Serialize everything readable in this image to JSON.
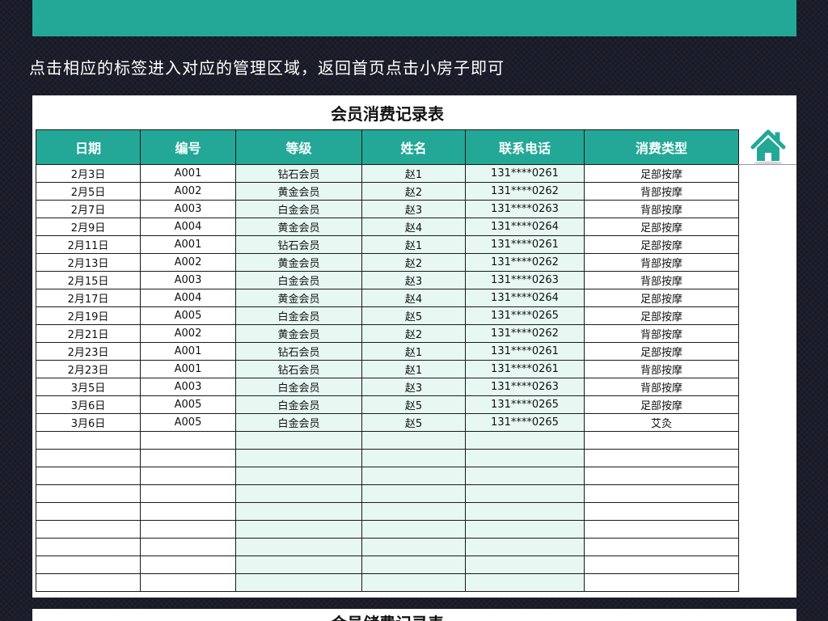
{
  "banner": {
    "instruction": "点击相应的标签进入对应的管理区域，返回首页点击小房子即可"
  },
  "sheet": {
    "title": "会员消费记录表",
    "columns": [
      "日期",
      "编号",
      "等级",
      "姓名",
      "联系电话",
      "消费类型"
    ],
    "rows": [
      [
        "2月3日",
        "A001",
        "钻石会员",
        "赵1",
        "131****0261",
        "足部按摩"
      ],
      [
        "2月5日",
        "A002",
        "黄金会员",
        "赵2",
        "131****0262",
        "背部按摩"
      ],
      [
        "2月7日",
        "A003",
        "白金会员",
        "赵3",
        "131****0263",
        "背部按摩"
      ],
      [
        "2月9日",
        "A004",
        "黄金会员",
        "赵4",
        "131****0264",
        "足部按摩"
      ],
      [
        "2月11日",
        "A001",
        "钻石会员",
        "赵1",
        "131****0261",
        "足部按摩"
      ],
      [
        "2月13日",
        "A002",
        "黄金会员",
        "赵2",
        "131****0262",
        "背部按摩"
      ],
      [
        "2月15日",
        "A003",
        "白金会员",
        "赵3",
        "131****0263",
        "背部按摩"
      ],
      [
        "2月17日",
        "A004",
        "黄金会员",
        "赵4",
        "131****0264",
        "足部按摩"
      ],
      [
        "2月19日",
        "A005",
        "白金会员",
        "赵5",
        "131****0265",
        "足部按摩"
      ],
      [
        "2月21日",
        "A002",
        "黄金会员",
        "赵2",
        "131****0262",
        "背部按摩"
      ],
      [
        "2月23日",
        "A001",
        "钻石会员",
        "赵1",
        "131****0261",
        "足部按摩"
      ],
      [
        "2月23日",
        "A001",
        "钻石会员",
        "赵1",
        "131****0261",
        "背部按摩"
      ],
      [
        "3月5日",
        "A003",
        "白金会员",
        "赵3",
        "131****0263",
        "背部按摩"
      ],
      [
        "3月6日",
        "A005",
        "白金会员",
        "赵5",
        "131****0265",
        "足部按摩"
      ],
      [
        "3月6日",
        "A005",
        "白金会员",
        "赵5",
        "131****0265",
        "艾灸"
      ],
      [
        "",
        "",
        "",
        "",
        "",
        ""
      ],
      [
        "",
        "",
        "",
        "",
        "",
        ""
      ],
      [
        "",
        "",
        "",
        "",
        "",
        ""
      ],
      [
        "",
        "",
        "",
        "",
        "",
        ""
      ],
      [
        "",
        "",
        "",
        "",
        "",
        ""
      ],
      [
        "",
        "",
        "",
        "",
        "",
        ""
      ],
      [
        "",
        "",
        "",
        "",
        "",
        ""
      ],
      [
        "",
        "",
        "",
        "",
        "",
        ""
      ],
      [
        "",
        "",
        "",
        "",
        "",
        ""
      ]
    ],
    "home_icon": "house-icon"
  },
  "next_sheet": {
    "title": "会员储费记录表"
  },
  "colors": {
    "accent": "#23a897",
    "mint": "#e7f8f3",
    "background": "#1c1d2b"
  }
}
